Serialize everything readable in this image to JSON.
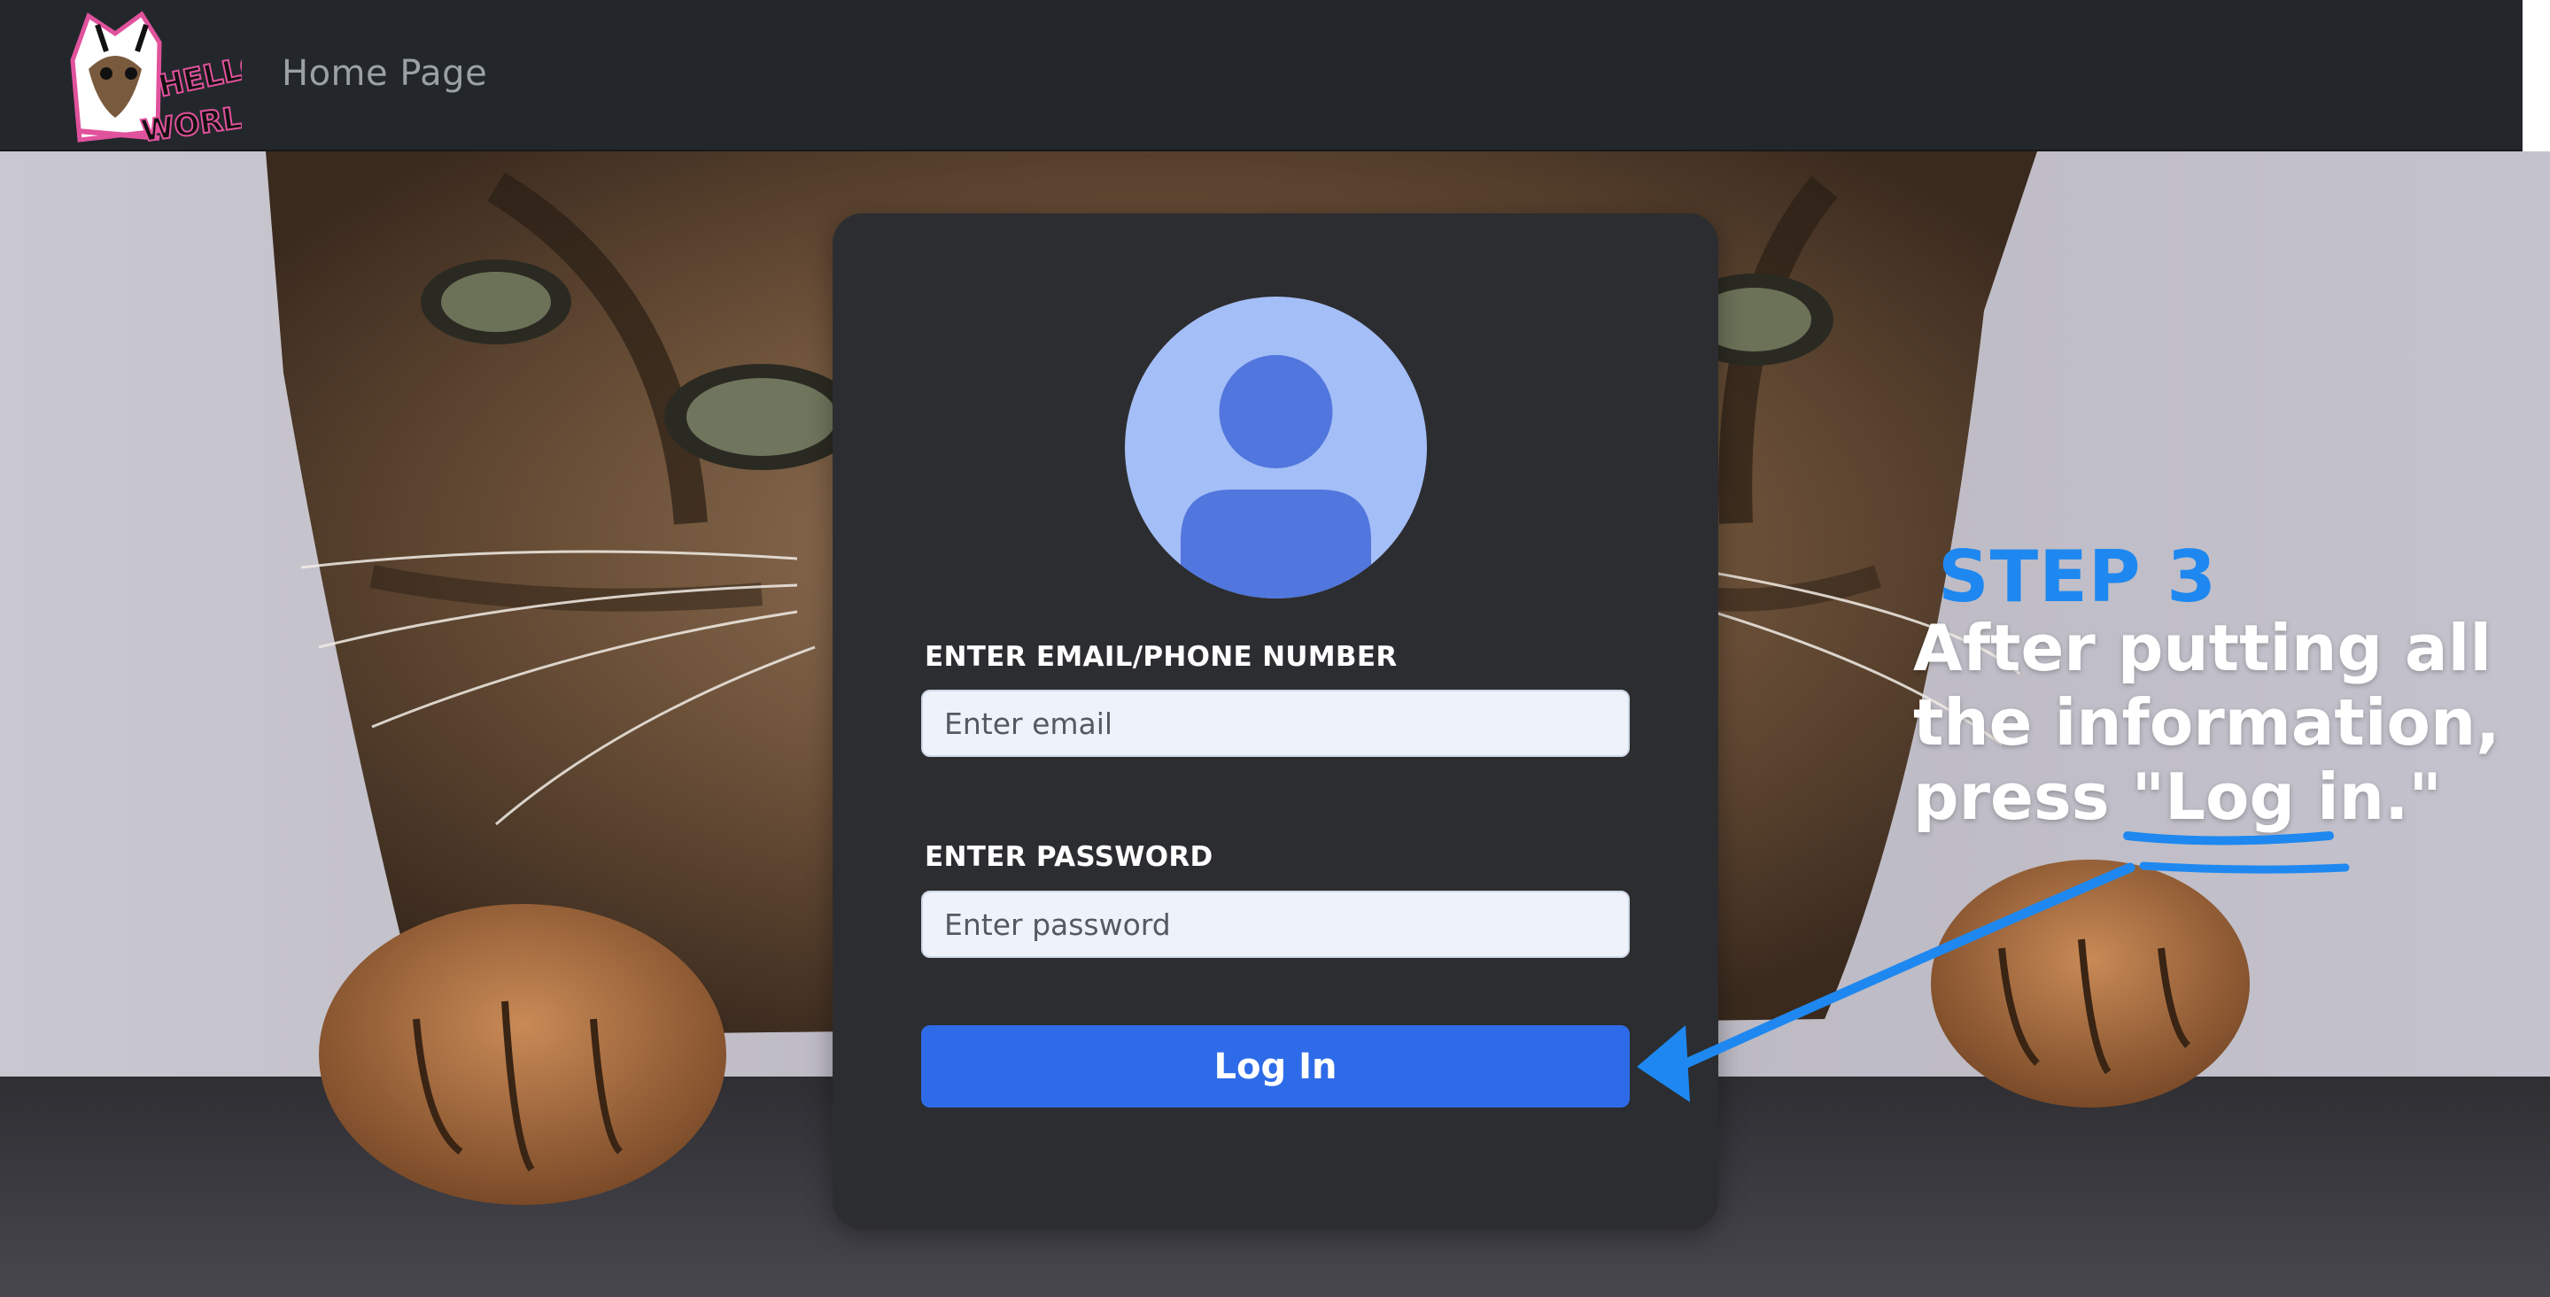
{
  "navbar": {
    "home_link": "Home Page",
    "logo_alt": "HELLO WORLD"
  },
  "login_form": {
    "email_label": "ENTER EMAIL/PHONE NUMBER",
    "email_placeholder": "Enter email",
    "password_label": "ENTER PASSWORD",
    "password_placeholder": "Enter password",
    "login_button": "Log In"
  },
  "annotation": {
    "step_title": "STEP 3",
    "step_line1": "After putting all",
    "step_line2": "the information,",
    "step_line3_prefix": "press \"",
    "step_line3_highlight": "Log in",
    "step_line3_suffix": ".\""
  },
  "colors": {
    "navbar_bg": "#23272b",
    "card_bg": "#2c2d30",
    "button_bg": "#2e6be8",
    "annotation_blue": "#1e88f0",
    "avatar_bg": "#a4bef7",
    "avatar_figure": "#5176dd"
  },
  "icons": {
    "avatar": "user-avatar-icon",
    "arrow": "annotation-arrow-icon"
  }
}
